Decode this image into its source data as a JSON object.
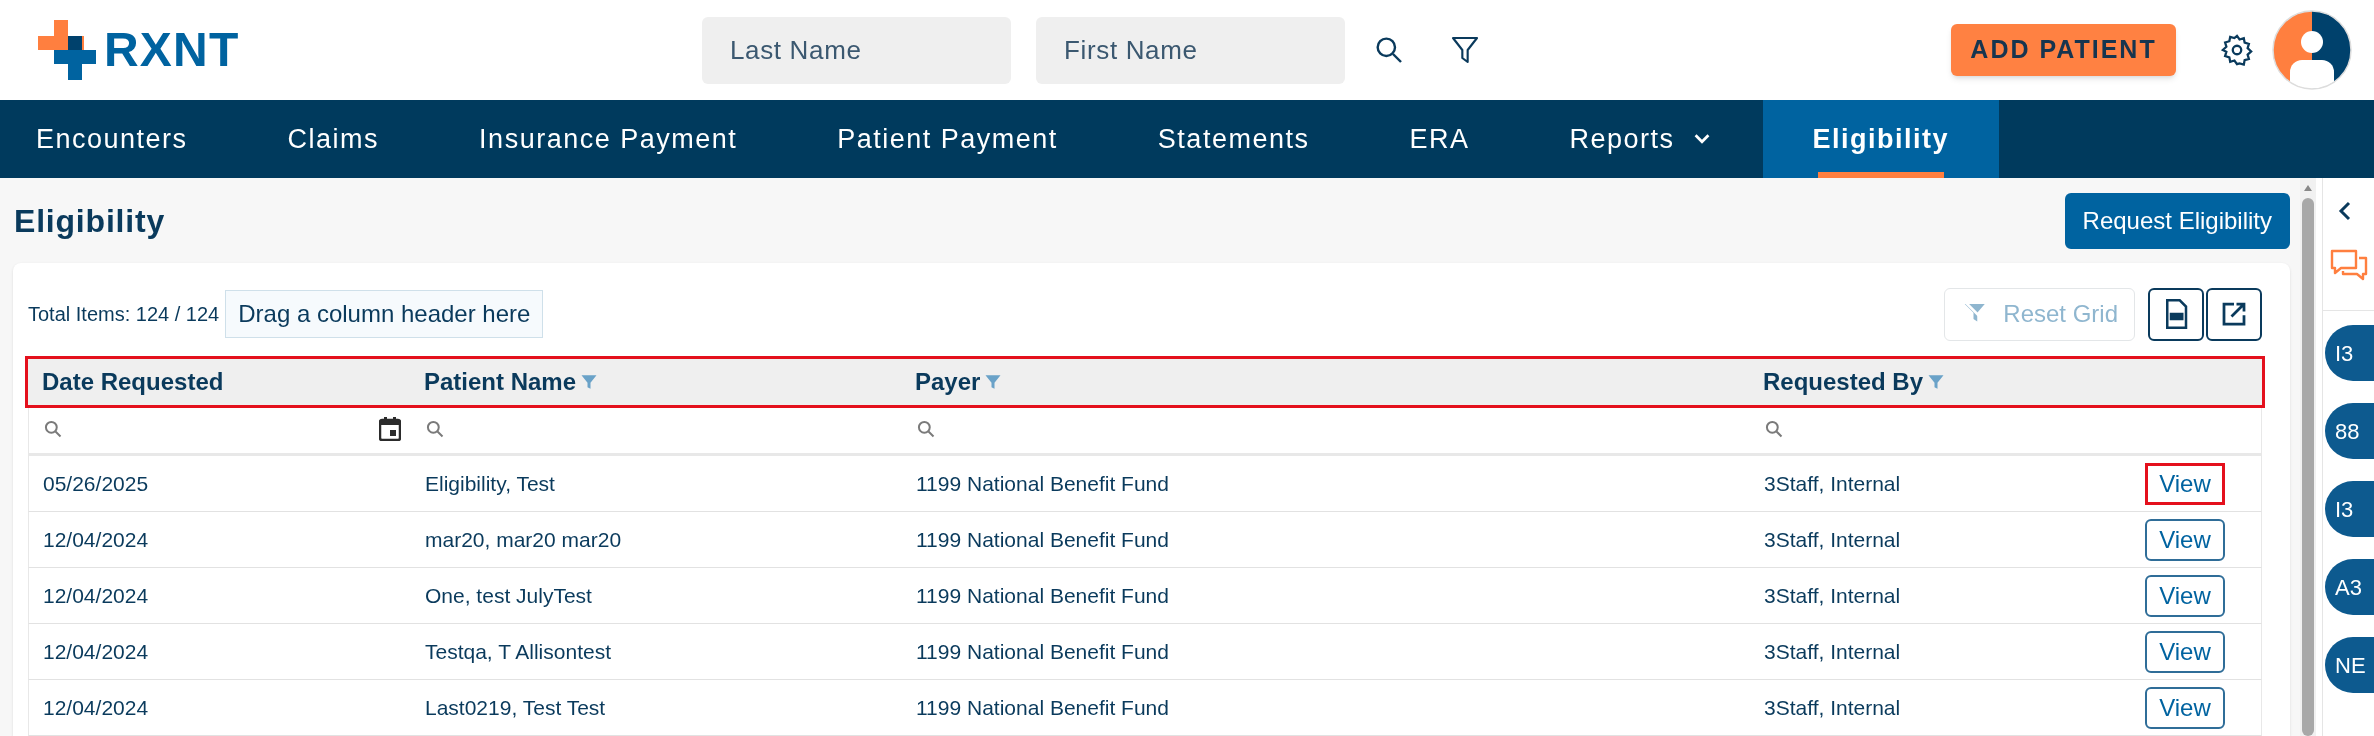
{
  "header": {
    "logo_text": "RXNT",
    "search_fields": [
      {
        "placeholder": "Last Name"
      },
      {
        "placeholder": "First Name"
      }
    ],
    "add_patient_button": "ADD PATIENT"
  },
  "nav": [
    {
      "label": "Encounters",
      "selected": false,
      "has_dropdown": false
    },
    {
      "label": "Claims",
      "selected": false,
      "has_dropdown": false
    },
    {
      "label": "Insurance Payment",
      "selected": false,
      "has_dropdown": false
    },
    {
      "label": "Patient Payment",
      "selected": false,
      "has_dropdown": false
    },
    {
      "label": "Statements",
      "selected": false,
      "has_dropdown": false
    },
    {
      "label": "ERA",
      "selected": false,
      "has_dropdown": false
    },
    {
      "label": "Reports",
      "selected": false,
      "has_dropdown": true
    },
    {
      "label": "Eligibility",
      "selected": true,
      "has_dropdown": false
    }
  ],
  "page_title": "Eligibility",
  "request_button": "Request Eligibility",
  "grid": {
    "total_items": "Total Items: 124 / 124",
    "group_panel": "Drag a column header here",
    "reset_button": {
      "label": "Reset Grid",
      "disabled": true
    },
    "header_highlighted": true,
    "columns": [
      {
        "label": "Date Requested",
        "filterable": false,
        "kind": "date"
      },
      {
        "label": "Patient Name",
        "filterable": true,
        "kind": "text"
      },
      {
        "label": "Payer",
        "filterable": true,
        "kind": "text"
      },
      {
        "label": "Requested By",
        "filterable": true,
        "kind": "text"
      }
    ],
    "rows": [
      {
        "date": "05/26/2025",
        "patient": "Eligibility, Test",
        "payer": "1199 National Benefit Fund",
        "requested_by": "3Staff, Internal",
        "action": "View",
        "highlighted": true
      },
      {
        "date": "12/04/2024",
        "patient": "mar20, mar20 mar20",
        "payer": "1199 National Benefit Fund",
        "requested_by": "3Staff, Internal",
        "action": "View",
        "highlighted": false
      },
      {
        "date": "12/04/2024",
        "patient": "One, test JulyTest",
        "payer": "1199 National Benefit Fund",
        "requested_by": "3Staff, Internal",
        "action": "View",
        "highlighted": false
      },
      {
        "date": "12/04/2024",
        "patient": "Testqa, T Allisontest",
        "payer": "1199 National Benefit Fund",
        "requested_by": "3Staff, Internal",
        "action": "View",
        "highlighted": false
      },
      {
        "date": "12/04/2024",
        "patient": "Last0219, Test Test",
        "payer": "1199 National Benefit Fund",
        "requested_by": "3Staff, Internal",
        "action": "View",
        "highlighted": false
      }
    ]
  },
  "side_panel": {
    "badges": [
      "I3",
      "88",
      "I3",
      "A3",
      "NE"
    ]
  }
}
